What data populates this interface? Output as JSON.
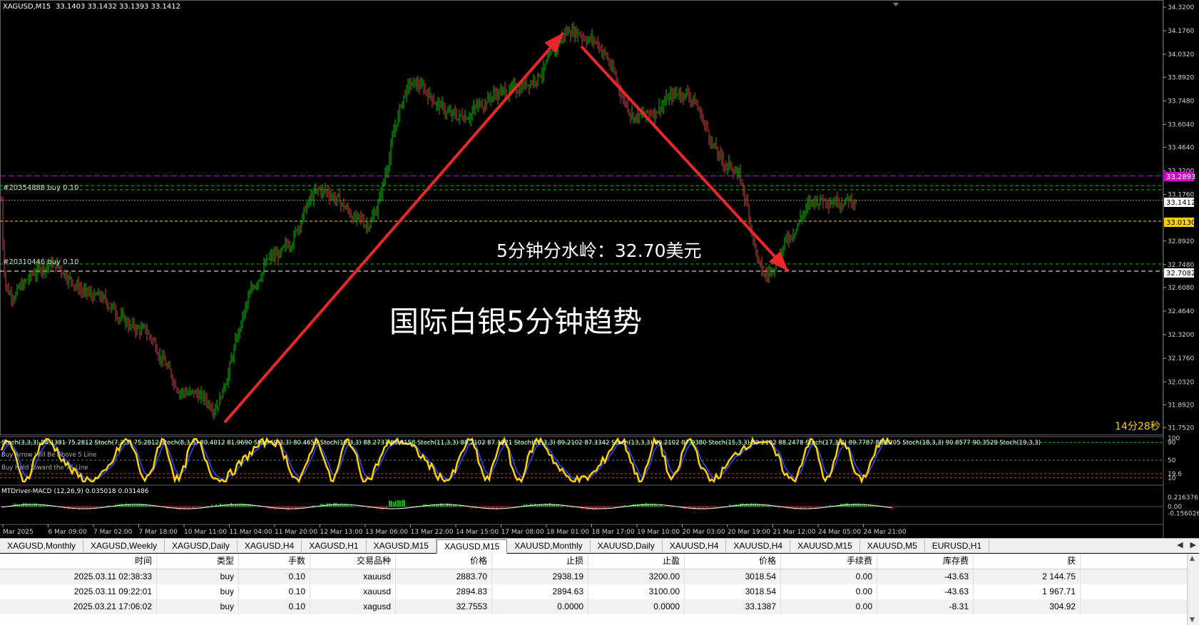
{
  "chart_header": {
    "symbol_label": "XAGUSD,M15",
    "ohlc": "33.1403 33.1432 33.1393 33.1412"
  },
  "annotations": {
    "order_label_1": "#20354888 buy 0.10",
    "order_label_2": "#20310446 buy 0.10",
    "watershed_text": "5分钟分水岭：32.70美元",
    "title_text": "国际白银5分钟趋势",
    "countdown": "14分28秒"
  },
  "price_axis": {
    "ticks": [
      "34.3200",
      "34.1760",
      "34.0320",
      "33.8920",
      "33.7480",
      "33.6040",
      "33.4640",
      "33.3200",
      "33.1760",
      "32.8920",
      "32.7480",
      "32.6080",
      "32.4640",
      "32.3200",
      "32.1760",
      "32.0320",
      "31.8920",
      "31.7520"
    ],
    "marker_magenta": "33.2893",
    "marker_current": "33.1412",
    "marker_yellow": "33.0130",
    "marker_white": "32.7082"
  },
  "stoch_panel": {
    "axis_ticks": [
      "100",
      "90",
      "50",
      "19.6",
      "10"
    ],
    "legend_text": "Stoch(3,3,3) 84.1381 75.2812  Stoch(7,3,3) 75.2812  Stoch(8,3,3) 80.4012 81.9690  Stoch(9,3,3) 80.4659  Stoch(10,3,3) 88.2737 86.8158  Stoch(11,3,3) 88.2102 87.1921  Stoch(12,3,3) 89.2102 87.3342  Stoch(13,3,3) 89.2102 87.9380  Stoch(15,3,3) 89.2102 88.2478  Stoch(17,3,3) 89.7787 89.2205  Stoch(18,3,3) 90.8577 90.3529  Stoch(19,3,3)",
    "buy_arrow_text": "Buy Arrow Will Be Above 5 Line",
    "buy_hold_text": "Buy Hold Toward the 76 Line"
  },
  "macd_panel": {
    "label": "MTDriver-MACD (12,26,9) 0.035018 0.031486",
    "axis_ticks": [
      "0.216376",
      "0.00",
      "-0.156026"
    ]
  },
  "time_axis": [
    "Mar 2025",
    "6 Mar 09:00",
    "7 Mar 02:00",
    "7 Mar 18:00",
    "10 Mar 11:00",
    "11 Mar 04:00",
    "11 Mar 20:00",
    "12 Mar 13:00",
    "13 Mar 06:00",
    "13 Mar 22:00",
    "14 Mar 15:00",
    "17 Mar 08:00",
    "18 Mar 01:00",
    "18 Mar 17:00",
    "19 Mar 10:00",
    "20 Mar 03:00",
    "20 Mar 19:00",
    "21 Mar 12:00",
    "24 Mar 05:00",
    "24 Mar 21:00"
  ],
  "tabs": [
    "XAGUSD,Monthly",
    "XAGUSD,Weekly",
    "XAGUSD,Daily",
    "XAGUSD,H4",
    "XAGUSD,H1",
    "XAGUSD,M15",
    "XAGUSD,M15",
    "XAUUSD,Monthly",
    "XAUUSD,Daily",
    "XAUUSD,H4",
    "XAUUSD,H4",
    "XAUUSD,M15",
    "XAUUSD,M5",
    "EURUSD,H1"
  ],
  "active_tab_index": 6,
  "trade_table": {
    "headers": [
      "时间",
      "类型",
      "手数",
      "交易品种",
      "价格",
      "止损",
      "止盈",
      "价格",
      "手续费",
      "库存费",
      "获"
    ],
    "rows": [
      [
        "2025.03.11 02:38:33",
        "buy",
        "0.10",
        "xauusd",
        "2883.70",
        "2938.19",
        "3200.00",
        "3018.54",
        "0.00",
        "-43.63",
        "2 144.75"
      ],
      [
        "2025.03.11 09:22:01",
        "buy",
        "0.10",
        "xauusd",
        "2894.83",
        "2894.63",
        "3100.00",
        "3018.54",
        "0.00",
        "-43.63",
        "1 967.71"
      ],
      [
        "2025.03.21 17:06:02",
        "buy",
        "0.10",
        "xagusd",
        "32.7553",
        "0.0000",
        "0.0000",
        "33.1387",
        "0.00",
        "-8.31",
        "304.92"
      ]
    ]
  },
  "colors": {
    "background": "#000000",
    "bull": "#00c800",
    "bear": "#d04040",
    "arrow": "#e8282a",
    "stoch_main": "#ffd200",
    "stoch_signal": "#2a50ff",
    "magenta_line": "#d000d0",
    "green_dash": "#00c800",
    "yellow_dash": "#ffd200",
    "white_dash": "#ffffff"
  },
  "chart_data": {
    "type": "candlestick",
    "symbol": "XAGUSD",
    "timeframe": "M15",
    "ylim": [
      31.75,
      34.32
    ],
    "key_points": [
      {
        "time": "Mar 2025",
        "price": 32.55
      },
      {
        "time": "6 Mar 09:00",
        "price": 32.75
      },
      {
        "time": "7 Mar 02:00",
        "price": 32.55
      },
      {
        "time": "7 Mar 18:00",
        "price": 32.35
      },
      {
        "time": "10 Mar 11:00",
        "price": 31.98
      },
      {
        "time": "11 Mar 04:00",
        "price": 32.45
      },
      {
        "time": "11 Mar 20:00",
        "price": 32.8
      },
      {
        "time": "12 Mar 13:00",
        "price": 33.2
      },
      {
        "time": "13 Mar 06:00",
        "price": 33.0
      },
      {
        "time": "13 Mar 22:00",
        "price": 33.85
      },
      {
        "time": "14 Mar 15:00",
        "price": 33.65
      },
      {
        "time": "17 Mar 08:00",
        "price": 33.8
      },
      {
        "time": "18 Mar 01:00",
        "price": 33.9
      },
      {
        "time": "18 Mar 17:00",
        "price": 34.1
      },
      {
        "time": "19 Mar 10:00",
        "price": 33.65
      },
      {
        "time": "20 Mar 03:00",
        "price": 33.8
      },
      {
        "time": "20 Mar 19:00",
        "price": 33.35
      },
      {
        "time": "21 Mar 12:00",
        "price": 32.85
      },
      {
        "time": "24 Mar 05:00",
        "price": 33.15
      },
      {
        "time": "24 Mar 21:00",
        "price": 33.14
      }
    ],
    "extremes": {
      "low": 31.8,
      "high": 34.2,
      "recent_low": 32.7
    },
    "levels": {
      "magenta": 33.2893,
      "current": 33.1412,
      "yellow": 33.013,
      "white": 32.7082
    }
  }
}
